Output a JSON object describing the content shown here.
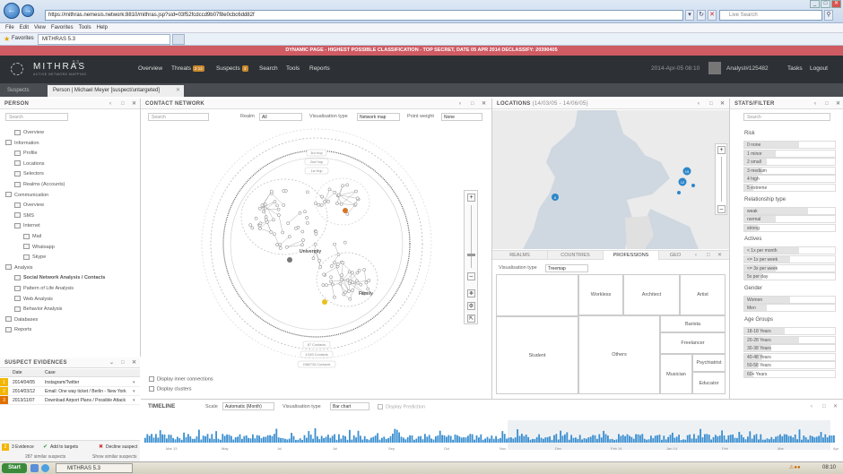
{
  "browser": {
    "url": "https://mithras.nemesis.network:8810/mithras.jsp?sid=03f52fcdccd9b07f8e0cbc6dd82f",
    "search_placeholder": "Live Search",
    "tab_title": "MITHRAS 5.3",
    "favorites": "Favorites",
    "menus": [
      "File",
      "Edit",
      "View",
      "Favorites",
      "Tools",
      "Help"
    ]
  },
  "classification": "DYNAMIC PAGE - HIGHEST POSSIBLE CLASSIFICATION - TOP SECRET, DATE 05 APR 2014 DECLASSIFY: 20390405",
  "app": {
    "logo": "MITHRAS",
    "version": "5.3",
    "tagline": "ACTIVE NETWORK MAPPING",
    "nav": [
      "Overview",
      "Threats",
      "Suspects",
      "Search",
      "Tools",
      "Reports"
    ],
    "threats_badge": "2 12",
    "suspects_badge": "2",
    "datetime": "2014-Apr-05 08:10",
    "user": "Analyst#125482",
    "tasks": "Tasks",
    "logout": "Logout"
  },
  "tabs": [
    "Suspects",
    "Person | Michael Meyer [suspect/untargeted]"
  ],
  "person": {
    "title": "PERSON",
    "search": "Search",
    "tree": [
      {
        "label": "Overview",
        "level": 1
      },
      {
        "label": "Information",
        "level": 0
      },
      {
        "label": "Profile",
        "level": 1
      },
      {
        "label": "Locations",
        "level": 1
      },
      {
        "label": "Selectors",
        "level": 1
      },
      {
        "label": "Realms (Accounts)",
        "level": 1
      },
      {
        "label": "Communication",
        "level": 0
      },
      {
        "label": "Overview",
        "level": 1
      },
      {
        "label": "SMS",
        "level": 1
      },
      {
        "label": "Internet",
        "level": 1
      },
      {
        "label": "Mail",
        "level": 2
      },
      {
        "label": "Whatsapp",
        "level": 2
      },
      {
        "label": "Skype",
        "level": 2
      },
      {
        "label": "Analysis",
        "level": 0
      },
      {
        "label": "Social Network Analysis / Contacts",
        "level": 1
      },
      {
        "label": "Pattern of Life Analysis",
        "level": 1
      },
      {
        "label": "Web Analysis",
        "level": 1
      },
      {
        "label": "Behavior Analysis",
        "level": 1
      },
      {
        "label": "Databases",
        "level": 0
      },
      {
        "label": "Reports",
        "level": 0
      }
    ]
  },
  "evidences": {
    "title": "SUSPECT EVIDENCES",
    "col_date": "Date",
    "col_case": "Case",
    "rows": [
      {
        "n": "1",
        "date": "2014/04/05",
        "case": "Instagram/Twitter"
      },
      {
        "n": "2",
        "date": "2014/03/12",
        "case": "Email: One way ticket / Berlin - New York"
      },
      {
        "n": "3",
        "date": "2013/11/07",
        "case": "Download Airport Plans / Possible Attack"
      }
    ],
    "footer": {
      "count": "3 Evidence",
      "add": "Add to targets",
      "decline": "Decline suspect",
      "similar": "287 similar suspects",
      "show": "Show similar suspects"
    }
  },
  "contact": {
    "title": "CONTACT NETWORK",
    "search": "Search",
    "realm_label": "Realm",
    "realm_value": "All",
    "vis_label": "Visualisation type",
    "vis_value": "Network map",
    "pw_label": "Point weight",
    "pw_value": "None",
    "labels": {
      "university": "University",
      "family": "Family"
    },
    "ring_top": [
      "3rd Hop",
      "2nd Hop",
      "1st Hop"
    ],
    "ring_bottom": [
      "87 Contacts",
      "1/183 Contacts",
      "2/86/726 Contacts"
    ],
    "opts": [
      "Display inner connections",
      "Display clusters"
    ]
  },
  "locations": {
    "title": "LOCATIONS",
    "range": "(14/03/05 - 14/06/05)",
    "markers": [
      "6",
      "19",
      "12"
    ],
    "tabs": [
      "REALMS",
      "COUNTRIES",
      "PROFESSIONS",
      "GEO"
    ],
    "vis_label": "Visualisation type",
    "vis_value": "Treemap",
    "treemap": [
      "Student",
      "Workless",
      "Architect",
      "Artist",
      "Others",
      "Barista",
      "Freelancer",
      "Musician",
      "Psychiatrist",
      "Educator"
    ]
  },
  "stats": {
    "title": "STATS/FILTER",
    "search": "Search",
    "groups": [
      {
        "title": "Risk",
        "items": [
          {
            "label": "0 none",
            "v": 0.6
          },
          {
            "label": "1 minor",
            "v": 0.35
          },
          {
            "label": "2 small",
            "v": 0.25
          },
          {
            "label": "3 medium",
            "v": 0.2
          },
          {
            "label": "4 high",
            "v": 0.15
          },
          {
            "label": "5 extreme",
            "v": 0.1
          }
        ]
      },
      {
        "title": "Relationship type",
        "items": [
          {
            "label": "weak",
            "v": 0.7
          },
          {
            "label": "normal",
            "v": 0.35
          },
          {
            "label": "strong",
            "v": 0.15
          }
        ]
      },
      {
        "title": "Actives",
        "items": [
          {
            "label": "< 1x per month",
            "v": 0.6
          },
          {
            "label": "<= 1x per week",
            "v": 0.5
          },
          {
            "label": "<= 3x per week",
            "v": 0.35
          },
          {
            "label": "5x per day",
            "v": 0.2
          }
        ]
      },
      {
        "title": "Gender",
        "items": [
          {
            "label": "Women",
            "v": 0.5
          },
          {
            "label": "Men",
            "v": 0.25
          }
        ]
      },
      {
        "title": "Age Groups",
        "items": [
          {
            "label": "18-18 Years",
            "v": 0.45
          },
          {
            "label": "20-28 Years",
            "v": 0.6
          },
          {
            "label": "30-38 Years",
            "v": 0.3
          },
          {
            "label": "40-48 Years",
            "v": 0.2
          },
          {
            "label": "50-58 Years",
            "v": 0.15
          },
          {
            "label": "60+ Years",
            "v": 0.1
          }
        ]
      }
    ]
  },
  "timeline": {
    "title": "TIMELINE",
    "scale_label": "Scale",
    "scale_value": "Automatic (Month)",
    "vis_label": "Visualisation type",
    "vis_value": "Bar chart",
    "prediction": "Display Prediction",
    "months": [
      "Mar 13",
      "May",
      "Jul",
      "Jul",
      "Sep",
      "Oct",
      "Nov",
      "Dec",
      "Feb 14",
      "Jan 14",
      "Feb",
      "Mar",
      "Apr 14"
    ]
  },
  "taskbar": {
    "start": "Start",
    "task": "MITHRAS 5.3",
    "clock": "08:10"
  }
}
